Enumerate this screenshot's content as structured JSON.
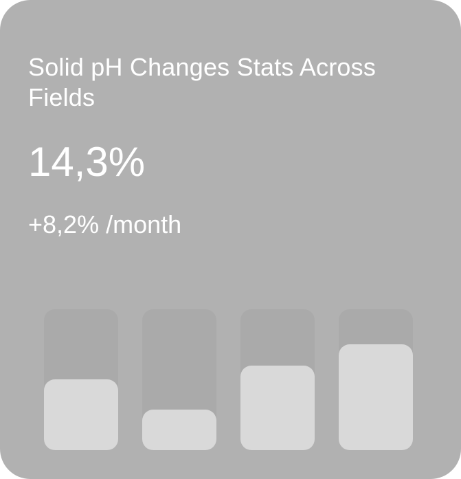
{
  "card": {
    "title": "Solid pH Changes Stats Across Fields",
    "value": "14,3%",
    "rate": "+8,2% /month"
  },
  "colors": {
    "card_background": "#b1b1b1",
    "bar_track": "#aaaaaa",
    "bar_fill": "#d9d9d9",
    "text": "#ffffff"
  },
  "chart_data": {
    "type": "bar",
    "categories": [
      "",
      "",
      "",
      ""
    ],
    "values": [
      0.5,
      0.29,
      0.6,
      0.75
    ],
    "ylim": [
      0,
      1
    ],
    "grid": false,
    "legend": "none"
  }
}
